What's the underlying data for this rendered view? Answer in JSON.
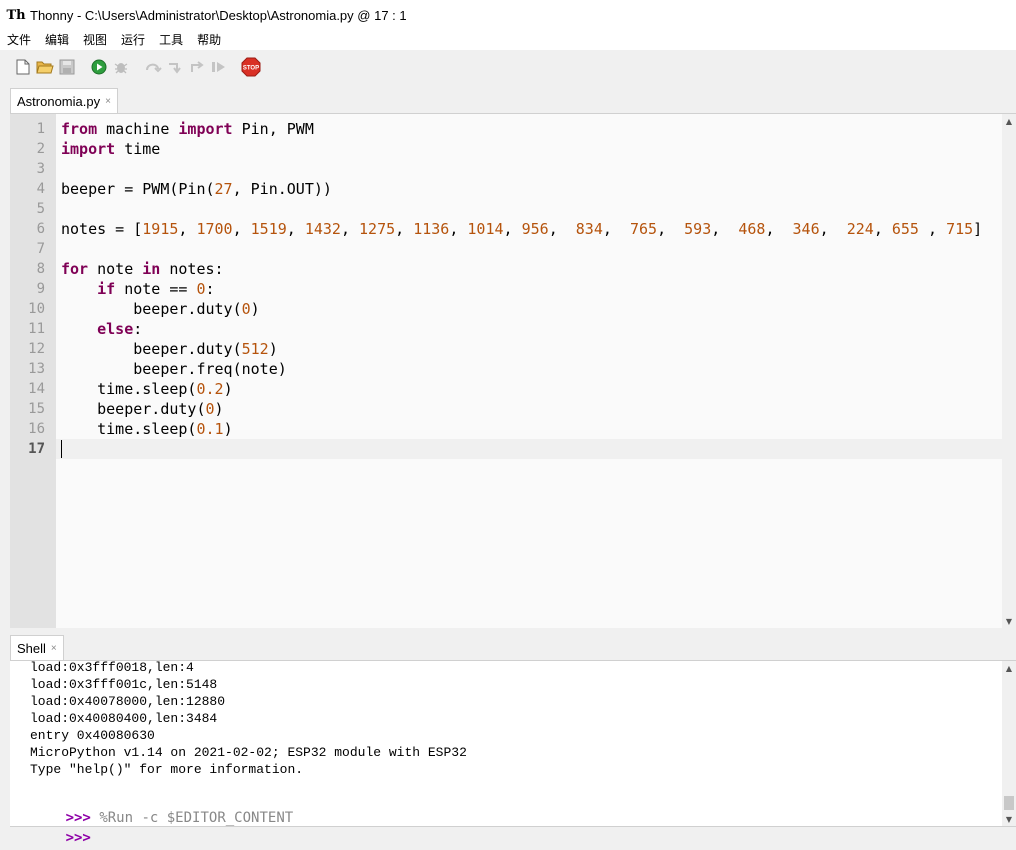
{
  "window": {
    "app_name": "Thonny",
    "title": "Thonny  -  C:\\Users\\Administrator\\Desktop\\Astronomia.py  @  17 : 1"
  },
  "menu": {
    "items": [
      "文件",
      "编辑",
      "视图",
      "运行",
      "工具",
      "帮助"
    ]
  },
  "toolbar": {
    "buttons": [
      {
        "name": "new-file",
        "icon": "new-file-icon",
        "enabled": true
      },
      {
        "name": "open-file",
        "icon": "folder-open-icon",
        "enabled": true
      },
      {
        "name": "save-file",
        "icon": "save-icon",
        "enabled": false
      },
      {
        "name": "run",
        "icon": "run-icon",
        "enabled": true
      },
      {
        "name": "debug",
        "icon": "bug-icon",
        "enabled": false
      },
      {
        "name": "step-over",
        "icon": "step-over-icon",
        "enabled": false
      },
      {
        "name": "step-into",
        "icon": "step-into-icon",
        "enabled": false
      },
      {
        "name": "step-out",
        "icon": "step-out-icon",
        "enabled": false
      },
      {
        "name": "resume",
        "icon": "resume-icon",
        "enabled": false
      },
      {
        "name": "stop",
        "icon": "stop-icon",
        "enabled": true,
        "label": "STOP"
      }
    ]
  },
  "editor": {
    "tab": {
      "label": "Astronomia.py",
      "close": "×"
    },
    "current_line": 17,
    "lines": [
      [
        {
          "t": "from",
          "c": "kw"
        },
        {
          "t": " machine "
        },
        {
          "t": "import",
          "c": "kw"
        },
        {
          "t": " Pin, PWM"
        }
      ],
      [
        {
          "t": "import",
          "c": "kw"
        },
        {
          "t": " time"
        }
      ],
      [],
      [
        {
          "t": "beeper = PWM(Pin("
        },
        {
          "t": "27",
          "c": "num"
        },
        {
          "t": ", Pin.OUT))"
        }
      ],
      [],
      [
        {
          "t": "notes = ["
        },
        {
          "t": "1915",
          "c": "num"
        },
        {
          "t": ", "
        },
        {
          "t": "1700",
          "c": "num"
        },
        {
          "t": ", "
        },
        {
          "t": "1519",
          "c": "num"
        },
        {
          "t": ", "
        },
        {
          "t": "1432",
          "c": "num"
        },
        {
          "t": ", "
        },
        {
          "t": "1275",
          "c": "num"
        },
        {
          "t": ", "
        },
        {
          "t": "1136",
          "c": "num"
        },
        {
          "t": ", "
        },
        {
          "t": "1014",
          "c": "num"
        },
        {
          "t": ", "
        },
        {
          "t": "956",
          "c": "num"
        },
        {
          "t": ",  "
        },
        {
          "t": "834",
          "c": "num"
        },
        {
          "t": ",  "
        },
        {
          "t": "765",
          "c": "num"
        },
        {
          "t": ",  "
        },
        {
          "t": "593",
          "c": "num"
        },
        {
          "t": ",  "
        },
        {
          "t": "468",
          "c": "num"
        },
        {
          "t": ",  "
        },
        {
          "t": "346",
          "c": "num"
        },
        {
          "t": ",  "
        },
        {
          "t": "224",
          "c": "num"
        },
        {
          "t": ", "
        },
        {
          "t": "655",
          "c": "num"
        },
        {
          "t": " , "
        },
        {
          "t": "715",
          "c": "num"
        },
        {
          "t": "]"
        }
      ],
      [],
      [
        {
          "t": "for",
          "c": "kw"
        },
        {
          "t": " note "
        },
        {
          "t": "in",
          "c": "kw"
        },
        {
          "t": " notes:"
        }
      ],
      [
        {
          "t": "    "
        },
        {
          "t": "if",
          "c": "kw"
        },
        {
          "t": " note == "
        },
        {
          "t": "0",
          "c": "num"
        },
        {
          "t": ":"
        }
      ],
      [
        {
          "t": "        beeper.duty("
        },
        {
          "t": "0",
          "c": "num"
        },
        {
          "t": ")"
        }
      ],
      [
        {
          "t": "    "
        },
        {
          "t": "else",
          "c": "kw"
        },
        {
          "t": ":"
        }
      ],
      [
        {
          "t": "        beeper.duty("
        },
        {
          "t": "512",
          "c": "num"
        },
        {
          "t": ")"
        }
      ],
      [
        {
          "t": "        beeper.freq(note)"
        }
      ],
      [
        {
          "t": "    time.sleep("
        },
        {
          "t": "0.2",
          "c": "num"
        },
        {
          "t": ")"
        }
      ],
      [
        {
          "t": "    beeper.duty("
        },
        {
          "t": "0",
          "c": "num"
        },
        {
          "t": ")"
        }
      ],
      [
        {
          "t": "    time.sleep("
        },
        {
          "t": "0.1",
          "c": "num"
        },
        {
          "t": ")"
        }
      ],
      []
    ]
  },
  "shell": {
    "tab": {
      "label": "Shell",
      "close": "×"
    },
    "output": [
      "load:0x3fff0018,len:4",
      "load:0x3fff001c,len:5148",
      "load:0x40078000,len:12880",
      "load:0x40080400,len:3484",
      "entry 0x40080630",
      "MicroPython v1.14 on 2021-02-02; ESP32 module with ESP32",
      "Type \"help()\" for more information."
    ],
    "prompt": ">>>",
    "last_command": "%Run -c $EDITOR_CONTENT",
    "input_value": ""
  }
}
